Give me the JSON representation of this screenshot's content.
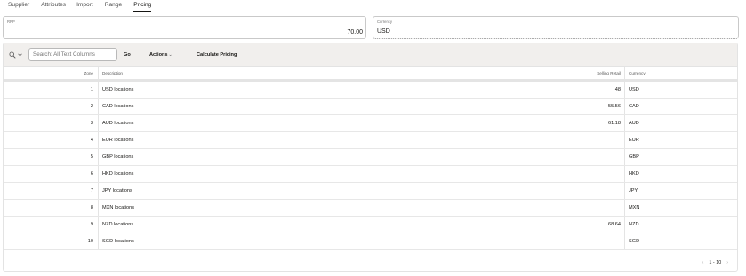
{
  "tabs": [
    {
      "label": "Supplier",
      "active": false
    },
    {
      "label": "Attributes",
      "active": false
    },
    {
      "label": "Import",
      "active": false
    },
    {
      "label": "Range",
      "active": false
    },
    {
      "label": "Pricing",
      "active": true
    }
  ],
  "form": {
    "rrp_label": "RRP",
    "rrp_value": "70.00",
    "currency_label": "Currency",
    "currency_value": "USD"
  },
  "toolbar": {
    "search_placeholder": "Search: All Text Columns",
    "go_label": "Go",
    "actions_label": "Actions",
    "calculate_label": "Calculate Pricing"
  },
  "table": {
    "headers": {
      "zone": "Zone",
      "description": "Description",
      "selling_retail": "Selling Retail",
      "currency": "Currency"
    },
    "rows": [
      {
        "zone": "1",
        "description": "USD locations",
        "selling_retail": "48",
        "currency": "USD"
      },
      {
        "zone": "2",
        "description": "CAD locations",
        "selling_retail": "55.56",
        "currency": "CAD"
      },
      {
        "zone": "3",
        "description": "AUD locations",
        "selling_retail": "61.18",
        "currency": "AUD"
      },
      {
        "zone": "4",
        "description": "EUR locations",
        "selling_retail": "",
        "currency": "EUR"
      },
      {
        "zone": "5",
        "description": "GBP locations",
        "selling_retail": "",
        "currency": "GBP"
      },
      {
        "zone": "6",
        "description": "HKD locations",
        "selling_retail": "",
        "currency": "HKD"
      },
      {
        "zone": "7",
        "description": "JPY locations",
        "selling_retail": "",
        "currency": "JPY"
      },
      {
        "zone": "8",
        "description": "MXN locations",
        "selling_retail": "",
        "currency": "MXN"
      },
      {
        "zone": "9",
        "description": "NZD locations",
        "selling_retail": "68.64",
        "currency": "NZD"
      },
      {
        "zone": "10",
        "description": "SGD locations",
        "selling_retail": "",
        "currency": "SGD"
      }
    ]
  },
  "pagination": {
    "range": "1 - 10"
  },
  "colors": {
    "toolbar_bg": "#f1efed",
    "text": "#161513",
    "border": "#c9c9c9"
  }
}
